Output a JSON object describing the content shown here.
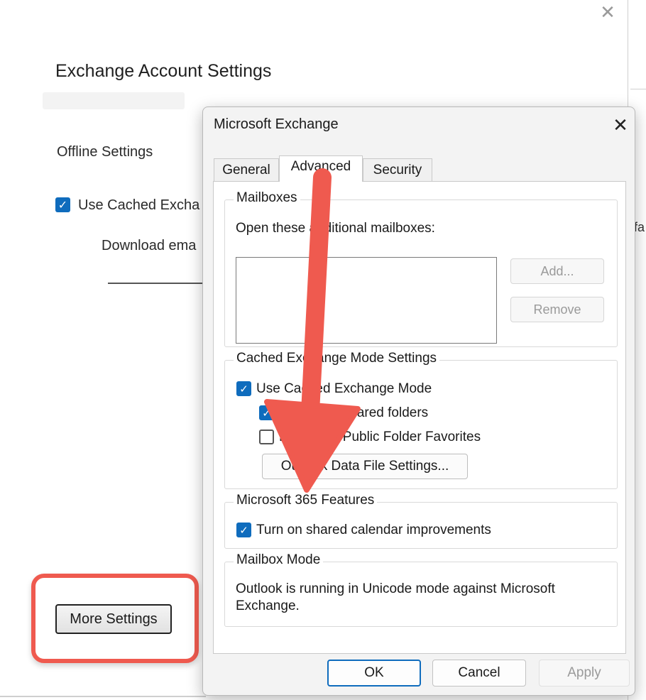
{
  "background_window": {
    "title": "Exchange Account Settings",
    "offline_settings_label": "Offline Settings",
    "use_cached_label": "Use Cached Excha",
    "download_label": "Download ema",
    "right_fragment": "fa",
    "more_settings_label": "More Settings",
    "close_glyph": "✕"
  },
  "dialog": {
    "title": "Microsoft Exchange",
    "close_glyph": "✕",
    "tabs": [
      {
        "label": "General",
        "selected": false
      },
      {
        "label": "Advanced",
        "selected": true
      },
      {
        "label": "Security",
        "selected": false
      }
    ],
    "mailboxes": {
      "group_label": "Mailboxes",
      "open_label": "Open these additional mailboxes:",
      "add_label": "Add...",
      "remove_label": "Remove"
    },
    "cached_mode": {
      "group_label": "Cached Exchange Mode Settings",
      "use_cached_label": "Use Cached Exchange Mode",
      "use_cached_checked": true,
      "download_shared_label": "Download shared folders",
      "download_shared_checked": true,
      "download_public_label": "Download Public Folder Favorites",
      "download_public_checked": false,
      "data_file_button": "Outlook Data File Settings..."
    },
    "m365": {
      "group_label": "Microsoft 365 Features",
      "shared_calendar_label": "Turn on shared calendar improvements",
      "shared_calendar_checked": true
    },
    "mailbox_mode": {
      "group_label": "Mailbox Mode",
      "text": "Outlook is running in Unicode mode against Microsoft Exchange."
    },
    "buttons": {
      "ok": "OK",
      "cancel": "Cancel",
      "apply": "Apply"
    }
  },
  "colors": {
    "accent": "#0f6cbd",
    "annotation": "#ef5a4f"
  },
  "icons": {
    "checkbox_checked": "check-icon",
    "close": "close-icon",
    "annotation_arrow": "arrow-down-icon"
  }
}
